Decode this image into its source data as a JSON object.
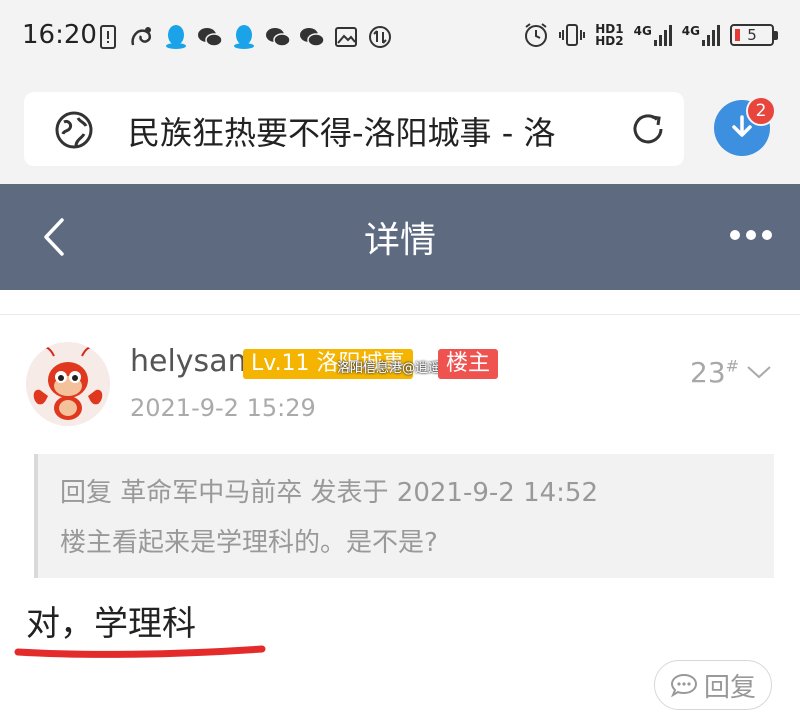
{
  "status_bar": {
    "time": "16:20",
    "hd1": "HD1",
    "hd2": "HD2",
    "sim1": "4G",
    "sim2": "4G",
    "battery": "5",
    "icons": [
      "sim-alert-icon",
      "uc-browser-icon",
      "qq-icon",
      "wechat-icon",
      "qq-icon",
      "wechat-icon",
      "wechat-icon",
      "gallery-icon",
      "data-transfer-icon"
    ]
  },
  "browser": {
    "url_title": "民族狂热要不得-洛阳城事 - 洛",
    "download_badge": "2"
  },
  "header": {
    "title": "详情"
  },
  "post": {
    "username": "helysan",
    "level_badge": "Lv.11 洛阳城事",
    "watermark": "洛阳信息港@逍遥而鱼",
    "owner_badge": "楼主",
    "floor": "23",
    "floor_mark": "#",
    "time": "2021-9-2 15:29",
    "quote_header": "回复 革命军中马前卒 发表于 2021-9-2 14:52",
    "quote_body": "楼主看起来是学理科的。是不是?",
    "reply_text": "对，学理科",
    "reply_button": "回复"
  },
  "colors": {
    "title_bar": "#5d6a80",
    "level_badge": "#f4b400",
    "owner_badge": "#ef5350",
    "download_button": "#3d8fe0",
    "underline": "#e32b2b"
  }
}
